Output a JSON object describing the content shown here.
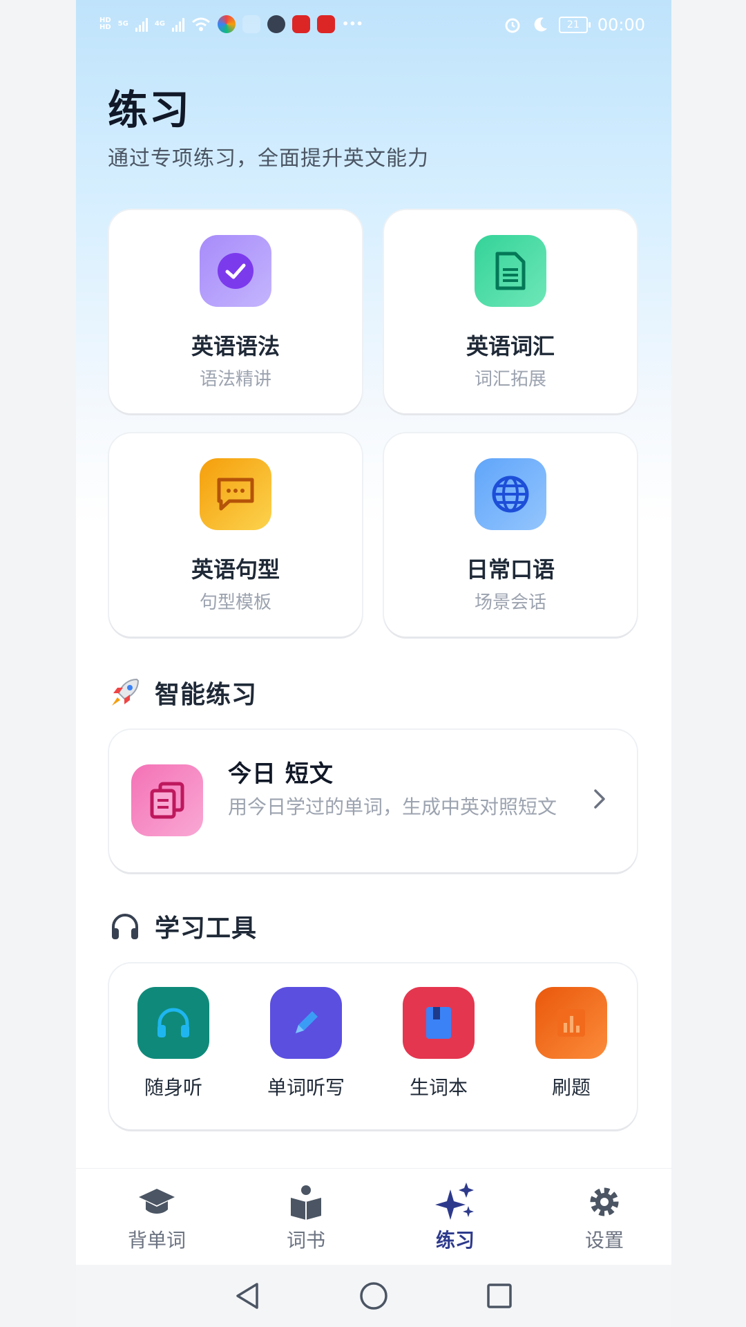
{
  "status_bar": {
    "time": "00:00",
    "battery": "21",
    "network_left": "5G",
    "network_right": "4G"
  },
  "header": {
    "title": "练习",
    "subtitle": "通过专项练习，全面提升英文能力"
  },
  "practice_cards": [
    {
      "title": "英语语法",
      "subtitle": "语法精讲",
      "icon": "check-circle-icon",
      "color": "#a78bfa"
    },
    {
      "title": "英语词汇",
      "subtitle": "词汇拓展",
      "icon": "document-icon",
      "color": "#34d399"
    },
    {
      "title": "英语句型",
      "subtitle": "句型模板",
      "icon": "chat-bubble-icon",
      "color": "#fbbf24"
    },
    {
      "title": "日常口语",
      "subtitle": "场景会话",
      "icon": "globe-icon",
      "color": "#60a5fa"
    }
  ],
  "smart_section": {
    "label": "智能练习",
    "icon": "rocket-icon",
    "item": {
      "title": "今日 短文",
      "description": "用今日学过的单词，生成中英对照短文",
      "icon": "copy-docs-icon",
      "color": "#f472b6"
    }
  },
  "tools_section": {
    "label": "学习工具",
    "icon": "headphones-icon",
    "items": [
      {
        "label": "随身听",
        "icon": "headphones-icon",
        "color": "#0f8a7a"
      },
      {
        "label": "单词听写",
        "icon": "pencil-icon",
        "color": "#5b4fe0"
      },
      {
        "label": "生词本",
        "icon": "book-icon",
        "color": "#e5364f"
      },
      {
        "label": "刷题",
        "icon": "bar-chart-icon",
        "color": "#f07020"
      }
    ]
  },
  "bottom_nav": {
    "items": [
      {
        "label": "背单词",
        "icon": "graduation-cap-icon"
      },
      {
        "label": "词书",
        "icon": "reading-book-icon"
      },
      {
        "label": "练习",
        "icon": "sparkles-icon",
        "active": true
      },
      {
        "label": "设置",
        "icon": "gear-icon"
      }
    ]
  }
}
